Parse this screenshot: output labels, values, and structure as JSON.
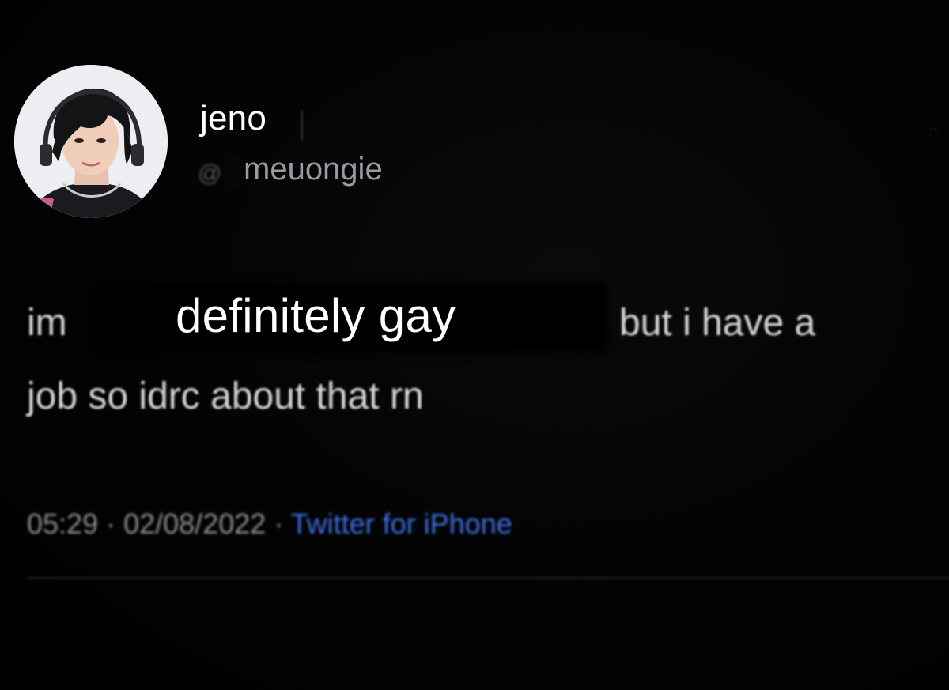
{
  "tweet": {
    "author": {
      "display_name": "jeno",
      "at_symbol": "@",
      "handle": "meuongie",
      "avatar_icon": "profile-photo"
    },
    "text": {
      "word_1": "im",
      "overlay_phrase": "definitely gay",
      "tail_line_1": "but i have a",
      "line_2": "job so idrc about that rn"
    },
    "meta": {
      "time": "05:29",
      "separator": "·",
      "date": "02/08/2022",
      "source": "Twitter for iPhone"
    },
    "menu_icon": "more-dots-icon"
  },
  "colors": {
    "background": "#000000",
    "name_text": "#ffffff",
    "handle_text": "#9a9aa0",
    "body_text": "#d6d6d8",
    "meta_text": "#8d8d92",
    "source_link": "#3d6fe0"
  }
}
